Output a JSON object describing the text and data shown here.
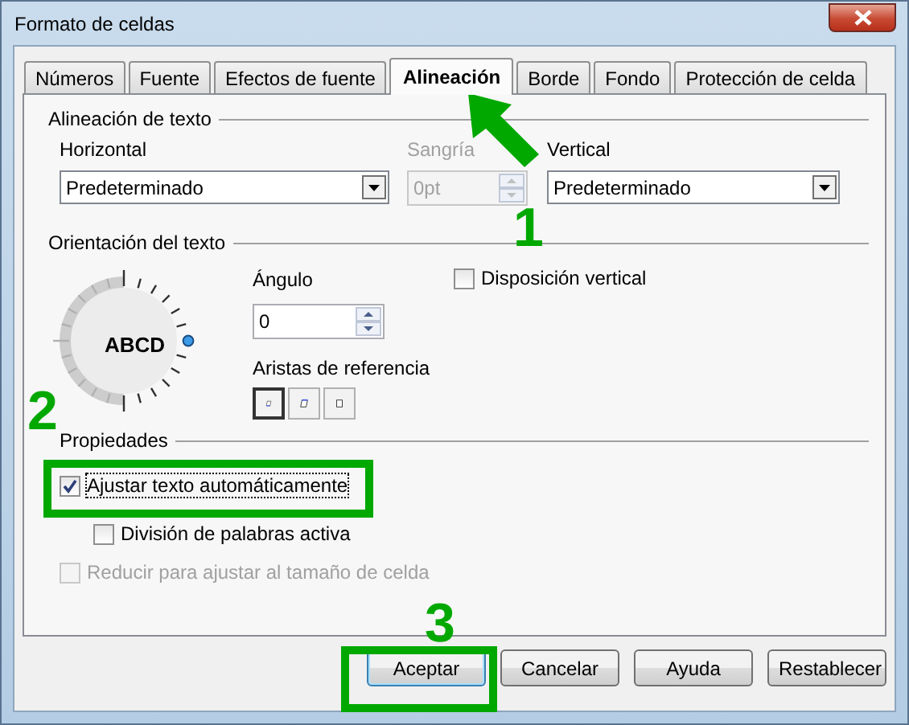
{
  "window": {
    "title": "Formato de celdas"
  },
  "tabs": [
    {
      "label": "Números",
      "selected": false
    },
    {
      "label": "Fuente",
      "selected": false
    },
    {
      "label": "Efectos de fuente",
      "selected": false
    },
    {
      "label": "Alineación",
      "selected": true
    },
    {
      "label": "Borde",
      "selected": false
    },
    {
      "label": "Fondo",
      "selected": false
    },
    {
      "label": "Protección de celda",
      "selected": false
    }
  ],
  "text_alignment": {
    "heading": "Alineación de texto",
    "horizontal": {
      "label": "Horizontal",
      "value": "Predeterminado"
    },
    "indent": {
      "label": "Sangría",
      "value": "0pt",
      "disabled": true
    },
    "vertical": {
      "label": "Vertical",
      "value": "Predeterminado"
    }
  },
  "text_orientation": {
    "heading": "Orientación del texto",
    "dial_text": "ABCD",
    "angle": {
      "label": "Ángulo",
      "value": "0"
    },
    "reference_edge": {
      "label": "Aristas de referencia",
      "options": [
        {
          "kind": "bottom",
          "selected": true
        },
        {
          "kind": "top",
          "selected": false
        },
        {
          "kind": "cell",
          "selected": false
        }
      ]
    },
    "vertical_stacking": {
      "label": "Disposición vertical",
      "checked": false
    }
  },
  "properties": {
    "heading": "Propiedades",
    "options": [
      {
        "label": "Ajustar texto automáticamente",
        "checked": true,
        "disabled": false,
        "focused": true,
        "children": [
          {
            "label": "División de palabras activa",
            "checked": false,
            "disabled": false,
            "focused": false
          }
        ]
      },
      {
        "label": "Reducir para ajustar al tamaño de celda",
        "checked": false,
        "disabled": true,
        "focused": false
      }
    ]
  },
  "buttons": [
    {
      "label": "Aceptar",
      "default": true
    },
    {
      "label": "Cancelar",
      "default": false
    },
    {
      "label": "Ayuda",
      "default": false
    },
    {
      "label": "Restablecer",
      "default": false
    }
  ],
  "annotations": [
    {
      "kind": "arrow"
    },
    {
      "kind": "number",
      "text": "1"
    },
    {
      "kind": "number",
      "text": "2"
    },
    {
      "kind": "frame"
    },
    {
      "kind": "number",
      "text": "3"
    },
    {
      "kind": "frame"
    }
  ]
}
